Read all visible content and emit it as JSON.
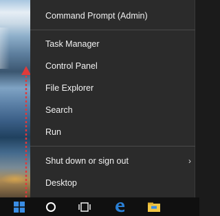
{
  "menu": {
    "items": [
      {
        "label": "Command Prompt (Admin)"
      },
      {
        "label": "Task Manager"
      },
      {
        "label": "Control Panel"
      },
      {
        "label": "File Explorer"
      },
      {
        "label": "Search"
      },
      {
        "label": "Run"
      },
      {
        "label": "Shut down or sign out",
        "has_submenu": true
      },
      {
        "label": "Desktop"
      }
    ],
    "submenu_arrow": "›"
  },
  "taskbar": {
    "icons": [
      "windows-start-icon",
      "cortana-circle-icon",
      "task-view-icon",
      "edge-browser-icon",
      "file-explorer-icon"
    ]
  },
  "colors": {
    "menu_background": "#2b2b2b",
    "menu_text": "#f2f2f2",
    "separator": "#4a4a4a",
    "taskbar": "#101010",
    "start_blue": "#3a8ee6",
    "arrow_red": "#e03a3a",
    "edge_blue": "#2a7fd4",
    "explorer_yellow": "#f2c744"
  }
}
